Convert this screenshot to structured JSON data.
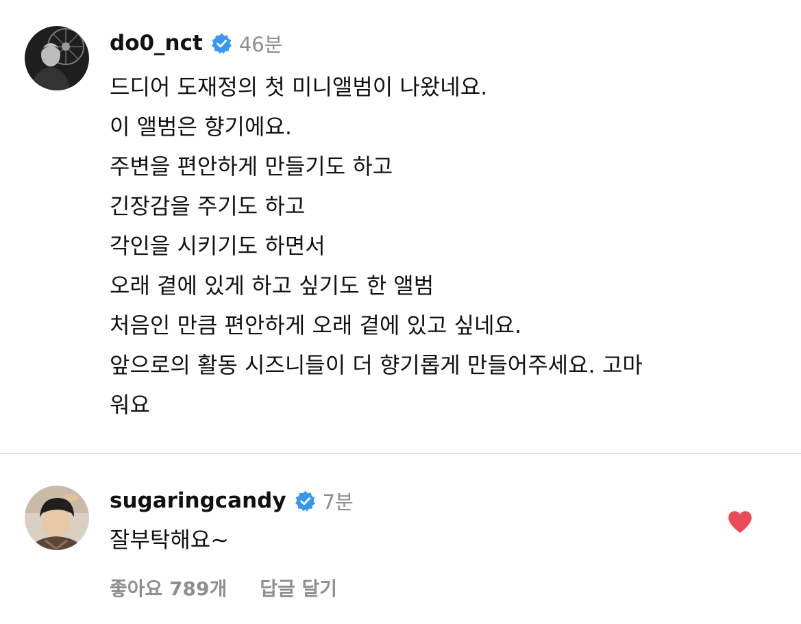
{
  "post": {
    "username": "do0_nct",
    "verified": true,
    "time": "46분",
    "caption_lines": [
      "드디어 도재정의 첫 미니앨범이 나왔네요.",
      "이 앨범은 향기에요.",
      "주변을 편안하게 만들기도 하고",
      "긴장감을 주기도 하고",
      "각인을 시키기도 하면서",
      "오래 곁에 있게 하고 싶기도 한 앨범",
      "처음인 만큼 편안하게 오래 곁에 있고 싶네요.",
      "앞으로의 활동 시즈니들이 더 향기롭게 만들어주세요. 고마",
      "워요"
    ]
  },
  "reply": {
    "username": "sugaringcandy",
    "verified": true,
    "time": "7분",
    "text": "잘부탁해요~",
    "likes_label": "좋아요 789개",
    "reply_label": "답글 달기",
    "liked": true
  },
  "colors": {
    "verified_blue": "#3897f0",
    "heart_red": "#ed4956",
    "secondary_text": "#8e8e8e",
    "divider": "#dbdbdb"
  },
  "icons": {
    "verified": "verified-badge-icon",
    "heart": "heart-filled-icon"
  }
}
